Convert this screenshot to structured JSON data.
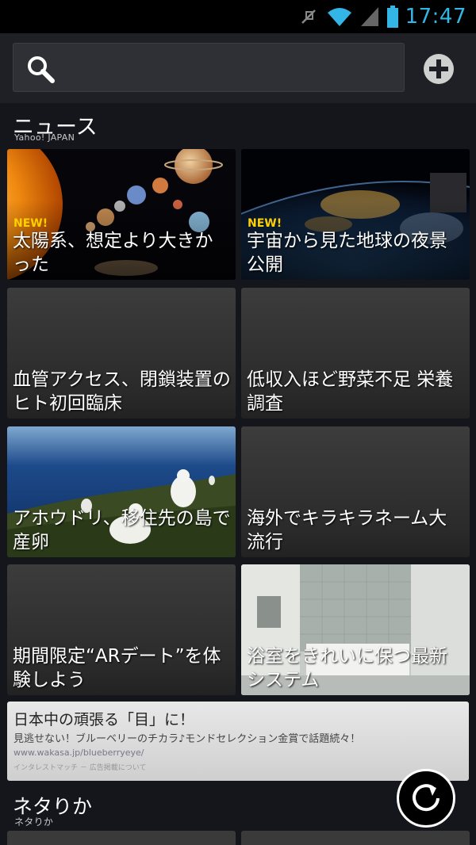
{
  "status_bar": {
    "time": "17:47",
    "icons": [
      "mute-icon",
      "wifi-icon",
      "signal-icon",
      "battery-icon"
    ],
    "accent": "#33b5e5"
  },
  "search": {
    "placeholder": ""
  },
  "sections": [
    {
      "title": "ニュース",
      "subtitle": "Yahoo! JAPAN"
    },
    {
      "title": "ネタりか",
      "subtitle": "ネタりか"
    }
  ],
  "tiles": [
    {
      "caption": "太陽系、想定より大きかった",
      "badge": "NEW!"
    },
    {
      "caption": "宇宙から見た地球の夜景公開",
      "badge": "NEW!"
    },
    {
      "caption": "血管アクセス、閉鎖装置のヒト初回臨床",
      "badge": ""
    },
    {
      "caption": "低収入ほど野菜不足 栄養調査",
      "badge": ""
    },
    {
      "caption": "アホウドリ、移住先の島で産卵",
      "badge": ""
    },
    {
      "caption": "海外でキラキラネーム大流行",
      "badge": ""
    },
    {
      "caption": "期間限定“ARデート”を体験しよう",
      "badge": ""
    },
    {
      "caption": "浴室をきれいに保つ最新システム",
      "badge": ""
    }
  ],
  "ad": {
    "headline": "日本中の頑張る「目」に！",
    "body": "見逃せない！ブルーベリーのチカラ♪モンドセレクション金賞で話題続々！",
    "url": "www.wakasa.jp/blueberryeye/",
    "sponsor": "インタレストマッチ － 広告掲載について"
  },
  "colors": {
    "badge": "#ffd000",
    "background": "#14161c"
  }
}
